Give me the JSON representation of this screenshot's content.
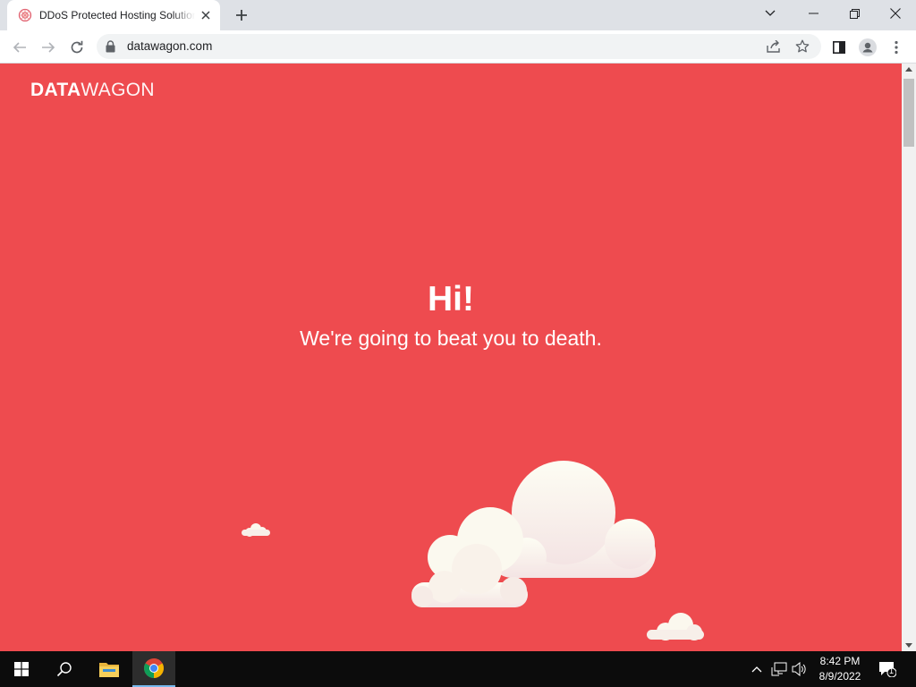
{
  "browser": {
    "tab_title": "DDoS Protected Hosting Solutions",
    "url": "datawagon.com",
    "icons": {
      "favicon": "datawagon-favicon-icon",
      "close_tab": "close-icon",
      "new_tab": "plus-icon",
      "tab_search": "chevron-down-icon",
      "minimize": "minimize-icon",
      "restore": "restore-icon",
      "close_window": "close-window-icon",
      "back": "back-arrow-icon",
      "forward": "forward-arrow-icon",
      "reload": "reload-icon",
      "lock": "lock-icon",
      "share": "share-icon",
      "bookmark": "star-icon",
      "side_panel": "side-panel-icon",
      "profile": "profile-icon",
      "menu": "kebab-menu-icon"
    }
  },
  "page": {
    "logo_bold": "DATA",
    "logo_light": "WAGON",
    "title": "Hi!",
    "subtitle": "We're going to beat you to death.",
    "background_color": "#ee4b4f"
  },
  "taskbar": {
    "time": "8:42 PM",
    "date": "8/9/2022",
    "notification_count": "1",
    "icons": [
      "windows-start-icon",
      "search-icon",
      "file-explorer-icon",
      "chrome-icon"
    ],
    "tray_icons": [
      "chevron-up-icon",
      "network-icon",
      "volume-icon",
      "notifications-icon"
    ]
  }
}
